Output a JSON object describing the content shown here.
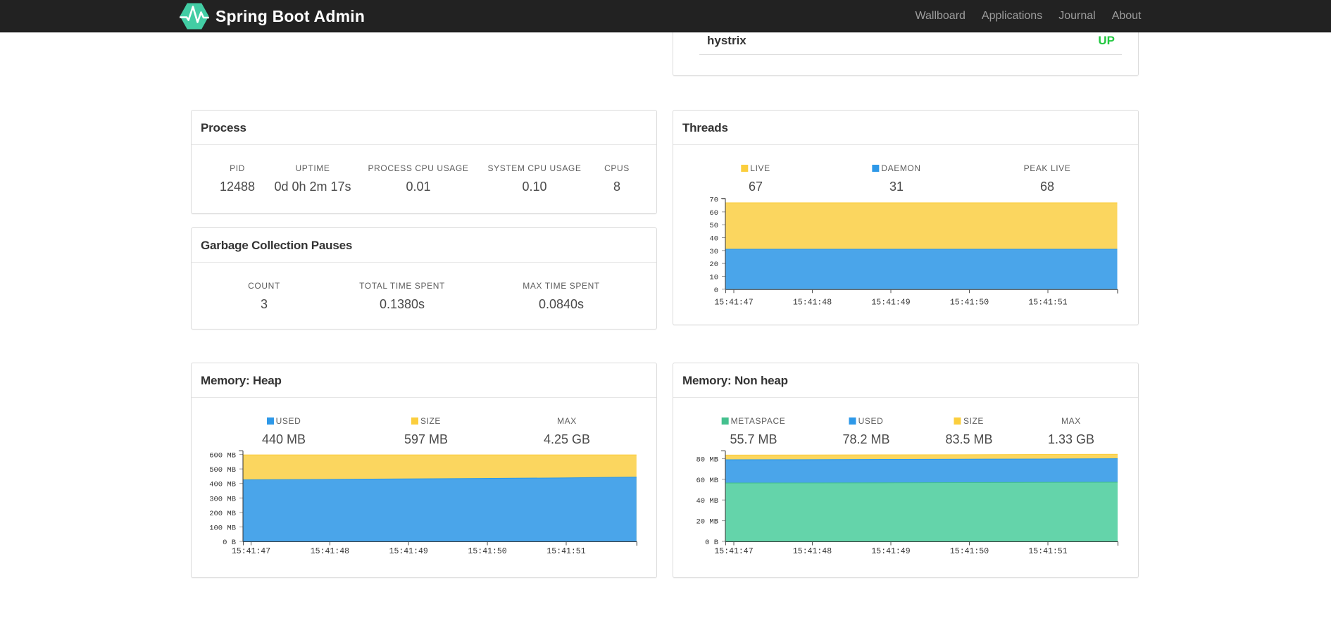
{
  "navbar": {
    "brand": "Spring Boot Admin",
    "links": [
      {
        "label": "Wallboard"
      },
      {
        "label": "Applications"
      },
      {
        "label": "Journal"
      },
      {
        "label": "About"
      }
    ]
  },
  "health_panel": {
    "application": "hystrix",
    "status": "UP",
    "status_color": "#22c840"
  },
  "process_panel": {
    "title": "Process",
    "metrics": [
      {
        "label": "PID",
        "value": "12488"
      },
      {
        "label": "UPTIME",
        "value": "0d 0h 2m 17s"
      },
      {
        "label": "PROCESS CPU USAGE",
        "value": "0.01"
      },
      {
        "label": "SYSTEM CPU USAGE",
        "value": "0.10"
      },
      {
        "label": "CPUS",
        "value": "8"
      }
    ]
  },
  "gc_panel": {
    "title": "Garbage Collection Pauses",
    "metrics": [
      {
        "label": "COUNT",
        "value": "3"
      },
      {
        "label": "TOTAL TIME SPENT",
        "value": "0.1380s"
      },
      {
        "label": "MAX TIME SPENT",
        "value": "0.0840s"
      }
    ]
  },
  "threads_panel": {
    "title": "Threads",
    "legend": [
      {
        "label": "LIVE",
        "value": "67",
        "color": "#fbce3d"
      },
      {
        "label": "DAEMON",
        "value": "31",
        "color": "#2d98e8"
      },
      {
        "label": "PEAK LIVE",
        "value": "68"
      }
    ]
  },
  "heap_panel": {
    "title": "Memory: Heap",
    "legend": [
      {
        "label": "USED",
        "value": "440 MB",
        "color": "#2d98e8"
      },
      {
        "label": "SIZE",
        "value": "597 MB",
        "color": "#fbce3d"
      },
      {
        "label": "MAX",
        "value": "4.25 GB"
      }
    ]
  },
  "nonheap_panel": {
    "title": "Memory: Non heap",
    "legend": [
      {
        "label": "METASPACE",
        "value": "55.7 MB",
        "color": "#44c08e"
      },
      {
        "label": "USED",
        "value": "78.2 MB",
        "color": "#2d98e8"
      },
      {
        "label": "SIZE",
        "value": "83.5 MB",
        "color": "#fbce3d"
      },
      {
        "label": "MAX",
        "value": "1.33 GB"
      }
    ]
  },
  "chart_data": [
    {
      "id": "threads",
      "type": "area",
      "ylim": [
        0,
        70
      ],
      "x_tick_labels": [
        "15:41:47",
        "15:41:48",
        "15:41:49",
        "15:41:50",
        "15:41:51"
      ],
      "y_ticks": [
        {
          "v": 0,
          "label": "0"
        },
        {
          "v": 10,
          "label": "10"
        },
        {
          "v": 20,
          "label": "20"
        },
        {
          "v": 30,
          "label": "30"
        },
        {
          "v": 40,
          "label": "40"
        },
        {
          "v": 50,
          "label": "50"
        },
        {
          "v": 60,
          "label": "60"
        },
        {
          "v": 70,
          "label": "70"
        }
      ],
      "x_fractions": [
        0,
        0.2,
        0.4,
        0.6,
        0.8,
        1
      ],
      "series": [
        {
          "name": "LIVE",
          "color": "#fbce3d",
          "fill": "#fbd65f",
          "values": [
            67,
            67,
            67,
            67,
            67,
            67
          ]
        },
        {
          "name": "DAEMON",
          "color": "#2d98e8",
          "fill": "#4aa5ea",
          "values": [
            31,
            31,
            31,
            31,
            31,
            31
          ]
        }
      ]
    },
    {
      "id": "heap",
      "type": "area",
      "ylim": [
        0,
        600
      ],
      "x_tick_labels": [
        "15:41:47",
        "15:41:48",
        "15:41:49",
        "15:41:50",
        "15:41:51"
      ],
      "y_ticks": [
        {
          "v": 0,
          "label": "0 B"
        },
        {
          "v": 100,
          "label": "100 MB"
        },
        {
          "v": 200,
          "label": "200 MB"
        },
        {
          "v": 300,
          "label": "300 MB"
        },
        {
          "v": 400,
          "label": "400 MB"
        },
        {
          "v": 500,
          "label": "500 MB"
        },
        {
          "v": 600,
          "label": "600 MB"
        }
      ],
      "x_fractions": [
        0,
        0.2,
        0.4,
        0.6,
        0.8,
        1
      ],
      "series": [
        {
          "name": "SIZE",
          "color": "#fbce3d",
          "fill": "#fbd65f",
          "values": [
            597,
            597,
            597,
            597,
            597,
            597
          ]
        },
        {
          "name": "USED",
          "color": "#2d98e8",
          "fill": "#4aa5ea",
          "values": [
            425,
            428,
            431,
            434,
            438,
            444
          ]
        }
      ]
    },
    {
      "id": "nonheap",
      "type": "area",
      "ylim": [
        0,
        88
      ],
      "x_tick_labels": [
        "15:41:47",
        "15:41:48",
        "15:41:49",
        "15:41:50",
        "15:41:51"
      ],
      "y_ticks": [
        {
          "v": 0,
          "label": "0 B"
        },
        {
          "v": 20,
          "label": "20 MB"
        },
        {
          "v": 40,
          "label": "40 MB"
        },
        {
          "v": 60,
          "label": "60 MB"
        },
        {
          "v": 80,
          "label": "80 MB"
        }
      ],
      "x_fractions": [
        0,
        0.2,
        0.4,
        0.6,
        0.8,
        1
      ],
      "series": [
        {
          "name": "SIZE",
          "color": "#fbce3d",
          "fill": "#fbd65f",
          "values": [
            83.4,
            83.5,
            83.6,
            83.8,
            84.0,
            84.2
          ]
        },
        {
          "name": "USED",
          "color": "#2d98e8",
          "fill": "#4aa5ea",
          "values": [
            78.9,
            79.0,
            79.2,
            79.4,
            79.6,
            79.9
          ]
        },
        {
          "name": "METASPACE",
          "color": "#44c08e",
          "fill": "#64d4aa",
          "values": [
            56.4,
            56.5,
            56.6,
            56.8,
            57.0,
            57.2
          ]
        }
      ]
    }
  ]
}
